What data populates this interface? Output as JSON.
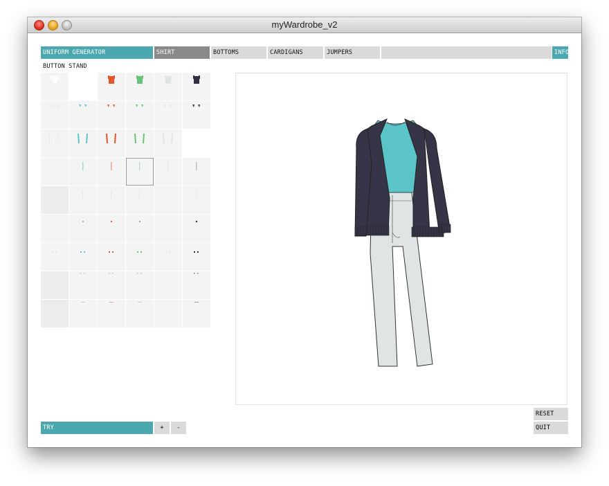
{
  "window": {
    "title": "myWardrobe_v2"
  },
  "tabs": [
    {
      "label": "UNIFORM GENERATOR"
    },
    {
      "label": "SHIRT"
    },
    {
      "label": "BOTTOMS"
    },
    {
      "label": "CARDIGANS"
    },
    {
      "label": "JUMPERS"
    },
    {
      "label": ""
    },
    {
      "label": "INFO"
    }
  ],
  "section": {
    "title": "BUTTON STAND"
  },
  "colors": {
    "accent": "#4ba8ae",
    "selected_tab": "#8a8a8a",
    "tab": "#dadada",
    "swatches": [
      "#ffffff",
      "#5bc4c9",
      "#e8542a",
      "#68c378",
      "#dfe4e4",
      "#2f2f40"
    ]
  },
  "outfit": {
    "shirt_color": "#5bc4c9",
    "cardigan_color": "#353547",
    "bottoms_color": "#dfe4e5"
  },
  "controls": {
    "try_label": "TRY",
    "plus_label": "+",
    "minus_label": "-",
    "reset_label": "RESET",
    "quit_label": "QUIT"
  }
}
